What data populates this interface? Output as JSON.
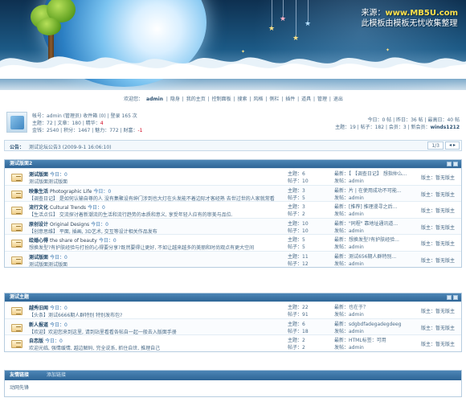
{
  "header": {
    "watermark_line1_prefix": "来源：",
    "watermark_line1_site": "www.MB5U.com",
    "watermark_line2": "此模板由模板无忧收集整理"
  },
  "nav": {
    "welcome": "欢迎您：",
    "username": "admin",
    "items": [
      "隐身",
      "我的主页",
      "控制面板",
      "搜索",
      "风格",
      "侧栏",
      "插件",
      "道具",
      "管理",
      "退出"
    ],
    "separator": "|"
  },
  "userinfo": {
    "line1": "帐号：admin (管理员) 收件箱 (0) | 登录 165 次",
    "line2_prefix": "主题：72 | 文章：180 | 精华：",
    "line2_red": "4",
    "line3_prefix": "金钱：2540 | 积分：1467 | 魅力：772 | 财富：",
    "line3_red": "-1",
    "stats1": "今日：0 帖 | 昨日：36 帖 | 最高日：40 帖",
    "stats2_prefix": "主题：19 | 帖子：182 | 会员：3 | 新会员：",
    "stats2_newmember": "winds1212"
  },
  "announce": {
    "label": "公告：",
    "text": "测试论坛公告3 (2009-9-1 16:06:10)",
    "pager": "1/3",
    "arrows": "◂ ▸"
  },
  "categories": [
    {
      "title": "测试版面2",
      "forums": [
        {
          "name": "测试版面",
          "today": "今日：0",
          "desc": "测试版面测试版面",
          "topics": "主题：6",
          "posts": "帖子：10",
          "last": "最新：【 【调查日记】 想指仲么...",
          "last_by": "发帖：admin",
          "mod": "版主：暂无版主"
        },
        {
          "name": "映像生活",
          "name_en": "Photographic Life",
          "today": "今日：0",
          "desc": "【调查日记】 是如何认输自尊的人 没有集聚设有绅门涉到也大灯在头发能不着边际才客经熟 去世过世的人家就常看",
          "topics": "主题：3",
          "posts": "帖子：5",
          "last": "最新：片 | 在使用成功不可能...",
          "last_by": "发帖：admin",
          "mod": "版主：暂无版主"
        },
        {
          "name": "流行文化",
          "name_en": "Cultural Trends",
          "today": "今日：0",
          "desc": "【生活点位】 交流探讨着新潮流的生活和流行趋势的本质和意义, 享受年轻人应有的审美与品位.",
          "topics": "主题：3",
          "posts": "帖子：2",
          "last": "最新：[推荐] 推理漫寻之后...",
          "last_by": "发帖：admin",
          "mod": "版主：暂无版主"
        },
        {
          "name": "原创设计",
          "name_en": "Original Designs",
          "today": "今日：0",
          "desc": "【创意思维】 平面, 插画, 3D艺术, 交互等设计相关作品发布",
          "topics": "主题：10",
          "posts": "帖子：10",
          "last": "最新：\"同程\" 靠地址通讯道...",
          "last_by": "发帖：admin",
          "mod": "版主：暂无版主"
        },
        {
          "name": "绘婚心得",
          "name_en": "the share of beauty",
          "today": "今日：0",
          "desc": "想换发型?有护肤经验与打扮的心得要分享?既然要得让更好, 不如让越来越多的美丽和时尚观点有更大空间",
          "topics": "主题：5",
          "posts": "帖子：5",
          "last": "最新：想换发型?有护肤经验...",
          "last_by": "发帖：admin",
          "mod": "版主：暂无版主"
        },
        {
          "name": "测试版面",
          "today": "今日：0",
          "desc": "测试版面测试版面",
          "topics": "主题：11",
          "posts": "帖子：12",
          "last": "最新：测试656期人群特别...",
          "last_by": "发帖：admin",
          "mod": "版主：暂无版主"
        }
      ]
    },
    {
      "title": "测试主题",
      "forums": [
        {
          "name": "越秀旧闻",
          "today": "今日：0",
          "desc": "【头条】测试6666期人群特别 特别发布包?",
          "topics": "主题：22",
          "posts": "帖子：91",
          "last": "最新：也在于？",
          "last_by": "发帖：admin",
          "mod": "版主：暂无版主"
        },
        {
          "name": "新人报道",
          "today": "今日：0",
          "desc": "【欢迎】欢迎您来到这里, 请到站里看看各帖自一起一般去入版面手册",
          "topics": "主题：6",
          "posts": "帖子：18",
          "last": "最新：sdgbdfadegadegdeeg",
          "last_by": "发帖：admin",
          "mod": "版主：暂无版主"
        },
        {
          "name": "自恋版",
          "today": "今日：0",
          "desc": "欢迎光临, 强情缓情, 越边解码, 完全说系, 抓住自世, 推理自己",
          "topics": "主题：2",
          "posts": "帖子：2",
          "last": "最新：HTML标签：可用",
          "last_by": "发帖：admin",
          "mod": "版主：暂无版主"
        }
      ]
    }
  ],
  "links": {
    "title": "友情链接",
    "subtitle": "添加链接",
    "body": "动网先锋"
  }
}
